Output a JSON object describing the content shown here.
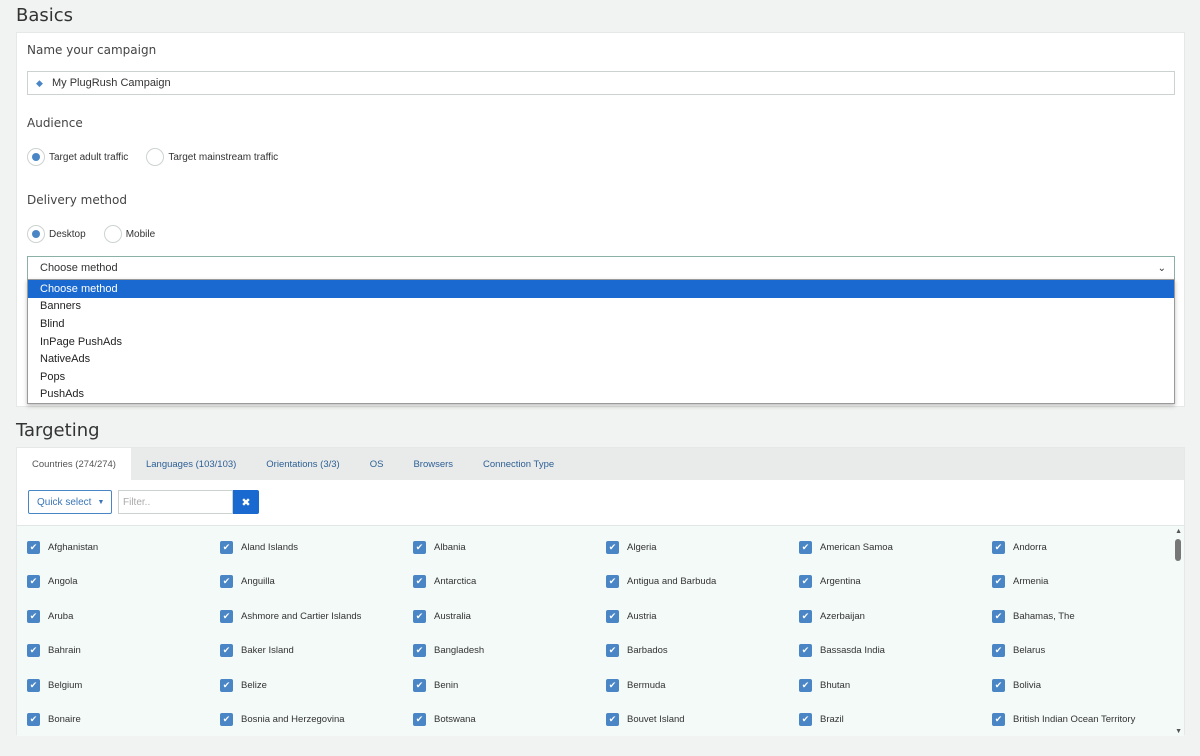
{
  "basics": {
    "title": "Basics",
    "name_label": "Name your campaign",
    "name_value": "My PlugRush Campaign",
    "audience_label": "Audience",
    "audience_options": [
      "Target adult traffic",
      "Target mainstream traffic"
    ],
    "delivery_label": "Delivery method",
    "delivery_options": [
      "Desktop",
      "Mobile"
    ],
    "method_select_value": "Choose method",
    "method_options": [
      "Choose method",
      "Banners",
      "Blind",
      "InPage PushAds",
      "NativeAds",
      "Pops",
      "PushAds"
    ]
  },
  "targeting": {
    "title": "Targeting",
    "tabs": [
      "Countries (274/274)",
      "Languages (103/103)",
      "Orientations (3/3)",
      "OS",
      "Browsers",
      "Connection Type"
    ],
    "quick_select": "Quick select",
    "filter_placeholder": "Filter..",
    "countries": [
      "Afghanistan",
      "Aland Islands",
      "Albania",
      "Algeria",
      "American Samoa",
      "Andorra",
      "Angola",
      "Anguilla",
      "Antarctica",
      "Antigua and Barbuda",
      "Argentina",
      "Armenia",
      "Aruba",
      "Ashmore and Cartier Islands",
      "Australia",
      "Austria",
      "Azerbaijan",
      "Bahamas, The",
      "Bahrain",
      "Baker Island",
      "Bangladesh",
      "Barbados",
      "Bassasda India",
      "Belarus",
      "Belgium",
      "Belize",
      "Benin",
      "Bermuda",
      "Bhutan",
      "Bolivia",
      "Bonaire",
      "Bosnia and Herzegovina",
      "Botswana",
      "Bouvet Island",
      "Brazil",
      "British Indian Ocean Territory"
    ]
  },
  "colors": {
    "accent": "#4a86c5",
    "primary_button": "#1a69d0",
    "tab_link": "#2d5f95"
  }
}
